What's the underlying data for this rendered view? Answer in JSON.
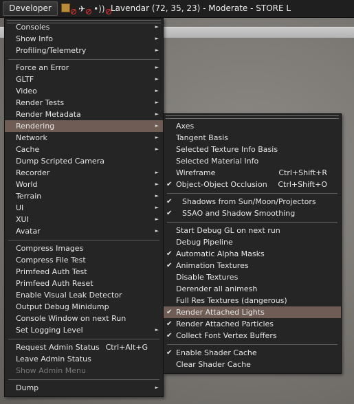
{
  "topbar": {
    "developer_label": "Developer",
    "location": "Lavendar (72, 35, 23) - Moderate - STORE L",
    "status_icons": [
      "build-icon",
      "no-build-icon",
      "fly-icon",
      "no-fly-icon",
      "voice-icon",
      "no-voice-icon"
    ]
  },
  "main_menu": {
    "items": [
      {
        "label": "Consoles",
        "submenu": true
      },
      {
        "label": "Show Info",
        "submenu": true
      },
      {
        "label": "Profiling/Telemetry",
        "submenu": true
      },
      {
        "label": "Force an Error",
        "submenu": true
      },
      {
        "label": "GLTF",
        "submenu": true
      },
      {
        "label": "Video",
        "submenu": true
      },
      {
        "label": "Render Tests",
        "submenu": true
      },
      {
        "label": "Render Metadata",
        "submenu": true
      },
      {
        "label": "Rendering",
        "submenu": true,
        "highlighted": true
      },
      {
        "label": "Network",
        "submenu": true
      },
      {
        "label": "Cache",
        "submenu": true
      },
      {
        "label": "Dump Scripted Camera"
      },
      {
        "label": "Recorder",
        "submenu": true
      },
      {
        "label": "World",
        "submenu": true
      },
      {
        "label": "Terrain",
        "submenu": true
      },
      {
        "label": "UI",
        "submenu": true
      },
      {
        "label": "XUI",
        "submenu": true
      },
      {
        "label": "Avatar",
        "submenu": true
      },
      {
        "label": "Compress Images"
      },
      {
        "label": "Compress File Test"
      },
      {
        "label": "Primfeed Auth Test"
      },
      {
        "label": "Primfeed Auth Reset"
      },
      {
        "label": "Enable Visual Leak Detector"
      },
      {
        "label": "Output Debug Minidump"
      },
      {
        "label": "Console Window on next Run"
      },
      {
        "label": "Set Logging Level",
        "submenu": true
      },
      {
        "label": "Request Admin Status",
        "shortcut": "Ctrl+Alt+G"
      },
      {
        "label": "Leave Admin Status"
      },
      {
        "label": "Show Admin Menu",
        "disabled": true
      },
      {
        "label": "Dump",
        "submenu": true
      }
    ]
  },
  "rendering_submenu": {
    "items": [
      {
        "label": "Axes"
      },
      {
        "label": "Tangent Basis"
      },
      {
        "label": "Selected Texture Info Basis"
      },
      {
        "label": "Selected Material Info"
      },
      {
        "label": "Wireframe",
        "shortcut": "Ctrl+Shift+R"
      },
      {
        "label": "Object-Object Occlusion",
        "shortcut": "Ctrl+Shift+O",
        "checked": true
      },
      {
        "label": "Shadows from Sun/Moon/Projectors",
        "checked": true
      },
      {
        "label": "SSAO and Shadow Smoothing",
        "checked": true
      },
      {
        "label": "Start Debug GL on next run"
      },
      {
        "label": "Debug Pipeline"
      },
      {
        "label": "Automatic Alpha Masks",
        "checked": true
      },
      {
        "label": "Animation Textures",
        "checked": true
      },
      {
        "label": "Disable Textures"
      },
      {
        "label": "Derender all animesh"
      },
      {
        "label": "Full Res Textures (dangerous)"
      },
      {
        "label": "Render Attached Lights",
        "checked": true,
        "highlighted": true
      },
      {
        "label": "Render Attached Particles",
        "checked": true
      },
      {
        "label": "Collect Font Vertex Buffers",
        "checked": true
      },
      {
        "label": "Enable Shader Cache",
        "checked": true
      },
      {
        "label": "Clear Shader Cache"
      }
    ]
  },
  "glyphs": {
    "check": "✔",
    "arrow": "►"
  }
}
